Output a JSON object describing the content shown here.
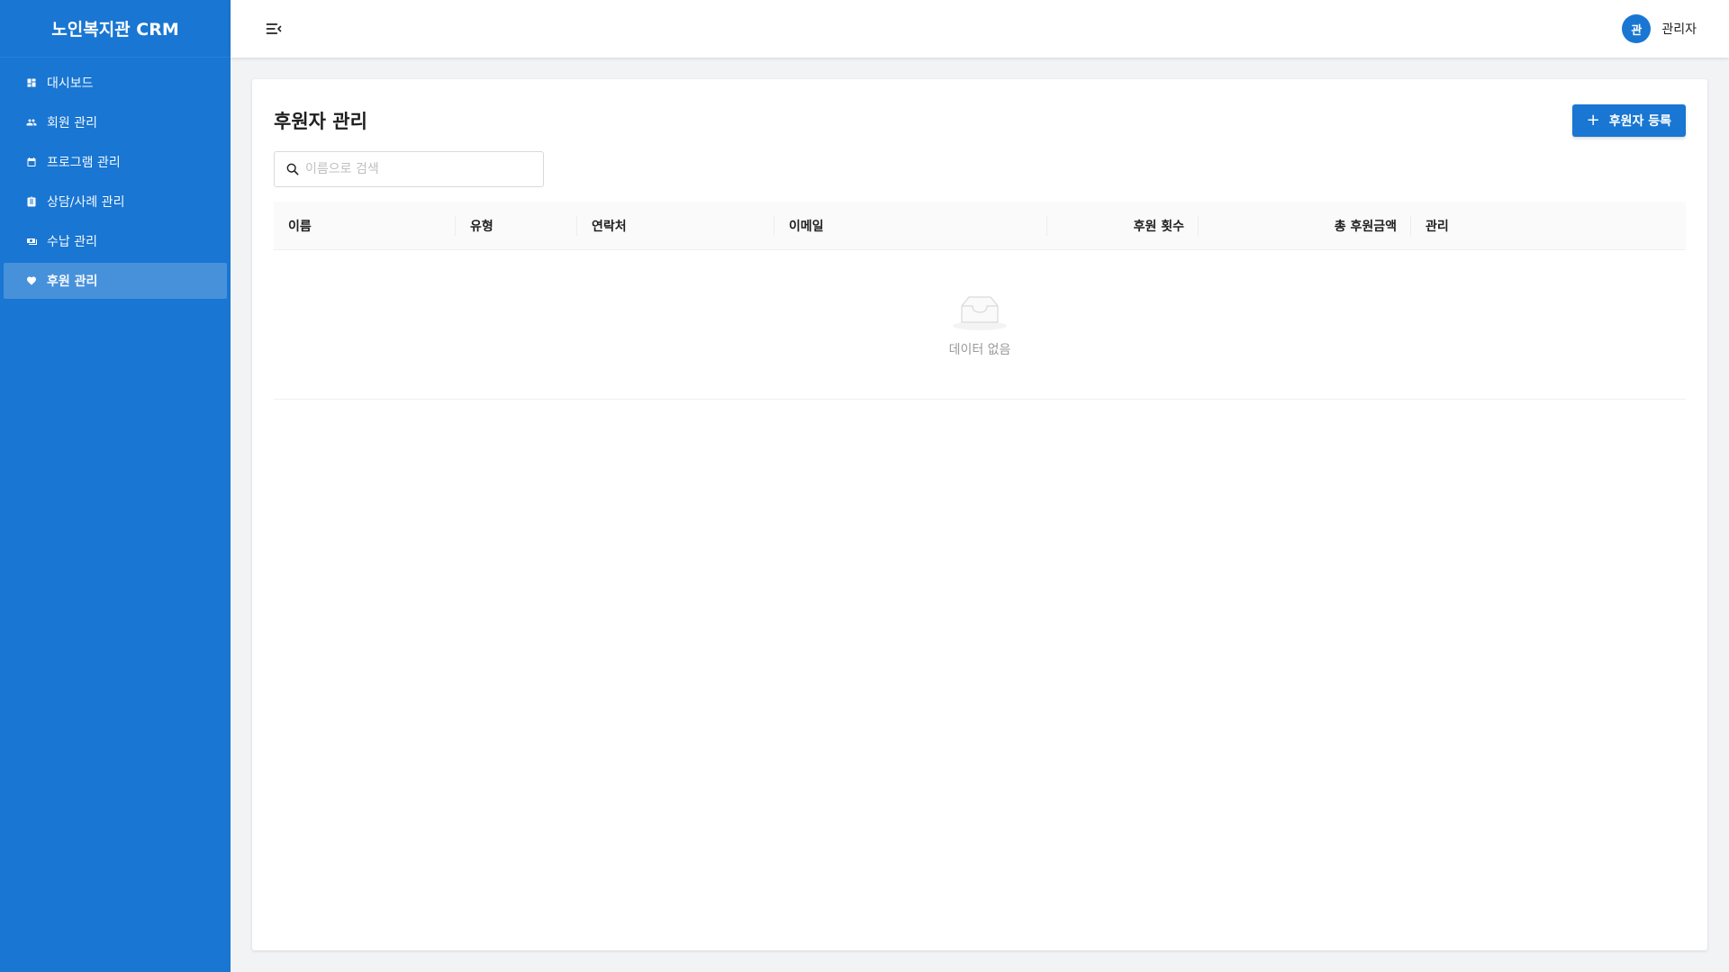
{
  "app": {
    "title": "노인복지관 CRM"
  },
  "sidebar": {
    "items": [
      {
        "label": "대시보드",
        "icon": "dashboard-icon"
      },
      {
        "label": "회원 관리",
        "icon": "users-icon"
      },
      {
        "label": "프로그램 관리",
        "icon": "calendar-icon"
      },
      {
        "label": "상담/사례 관리",
        "icon": "clipboard-icon"
      },
      {
        "label": "수납 관리",
        "icon": "money-icon"
      },
      {
        "label": "후원 관리",
        "icon": "heart-icon",
        "active": true
      }
    ]
  },
  "header": {
    "user": {
      "avatar_text": "관",
      "name": "관리자"
    }
  },
  "main": {
    "title": "후원자 관리",
    "add_button": "후원자 등록",
    "search": {
      "placeholder": "이름으로 검색",
      "value": ""
    },
    "table": {
      "columns": [
        "이름",
        "유형",
        "연락처",
        "이메일",
        "후원 횟수",
        "총 후원금액",
        "관리"
      ],
      "rows": [],
      "empty_text": "데이터 없음"
    }
  },
  "colors": {
    "primary": "#1976d2",
    "background": "#f2f3f5"
  }
}
